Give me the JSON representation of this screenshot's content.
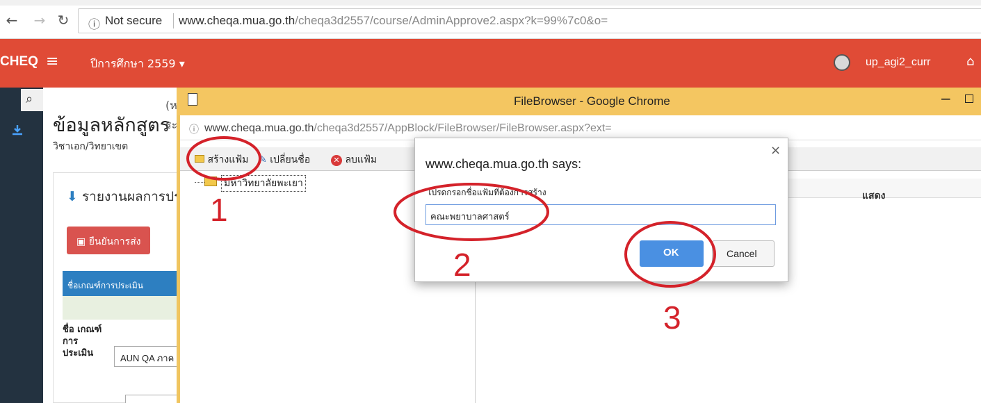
{
  "browser": {
    "security": "Not secure",
    "url_domain": "www.cheqa.mua.go.th",
    "url_path": "/cheqa3d2557/course/AdminApprove2.aspx?k=99%7c0&o="
  },
  "header": {
    "brand": "CHEQ",
    "year_menu": "ปีการศึกษา 2559 ▾",
    "user": "up_agi2_curr",
    "accent_color": "#e04b36"
  },
  "main": {
    "title": "ข้อมูลหลักสูตร",
    "title_suffix_1": "(ห",
    "title_suffix_2": "ระ",
    "subtitle": "วิชาเอก/วิทยาเขต",
    "report_title": "รายงานผลการปร",
    "confirm_button": "ยืนยันการส่ง",
    "criteria_header": "ชื่อเกณฑ์การประเมิน",
    "criteria_label": "ชื่อ เกณฑ์ การ ประเมิน",
    "criteria_value": "AUN QA ภาค"
  },
  "file_browser": {
    "window_title": "FileBrowser - Google Chrome",
    "url_domain": "www.cheqa.mua.go.th",
    "url_path": "/cheqa3d2557/AppBlock/FileBrowser/FileBrowser.aspx?ext=",
    "toolbar": {
      "create_folder": "สร้างแฟ้ม",
      "rename": "เปลี่ยนชื่อ",
      "delete_folder": "ลบแฟ้ม"
    },
    "tree_root": "มหาวิทยาลัยพะเยา",
    "column_show": "แสดง",
    "titlebar_color": "#f4c661"
  },
  "dialog": {
    "title": "www.cheqa.mua.go.th says:",
    "message": "โปรดกรอกชื่อแฟ้มที่ต้องการสร้าง",
    "input_value": "คณะพยาบาลศาสตร์",
    "ok": "OK",
    "cancel": "Cancel"
  },
  "annotations": {
    "step1": "1",
    "step2": "2",
    "step3": "3",
    "color": "#d4222a"
  }
}
